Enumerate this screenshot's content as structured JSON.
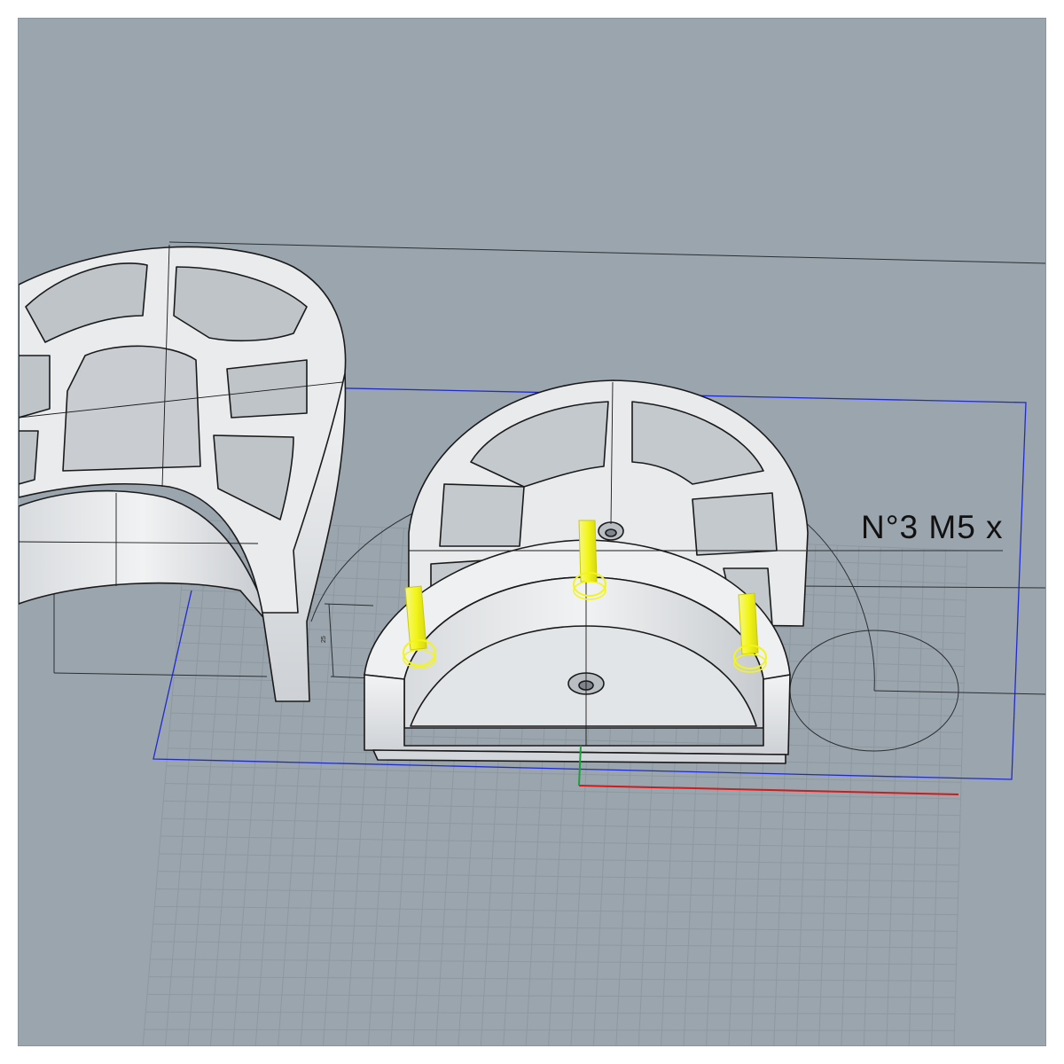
{
  "viewport": {
    "annotation_text": "N°3 M5 x",
    "dimension_label": "25"
  },
  "colors": {
    "background": "#9ba5ad",
    "grid": "#8e98a1",
    "bounding_box": "#1f2bd1",
    "part_fill": "#e6e8ea",
    "part_shade": "#c9cdd1",
    "part_edge": "#1a1a1a",
    "screw": "#f3f51a",
    "axis_x": "#d11a1a",
    "axis_y": "#19a03a"
  },
  "objects": {
    "bracket": "bracket-partial",
    "mount": "mount-with-pocket",
    "screws": [
      "screw-left",
      "screw-center",
      "screw-right"
    ]
  }
}
